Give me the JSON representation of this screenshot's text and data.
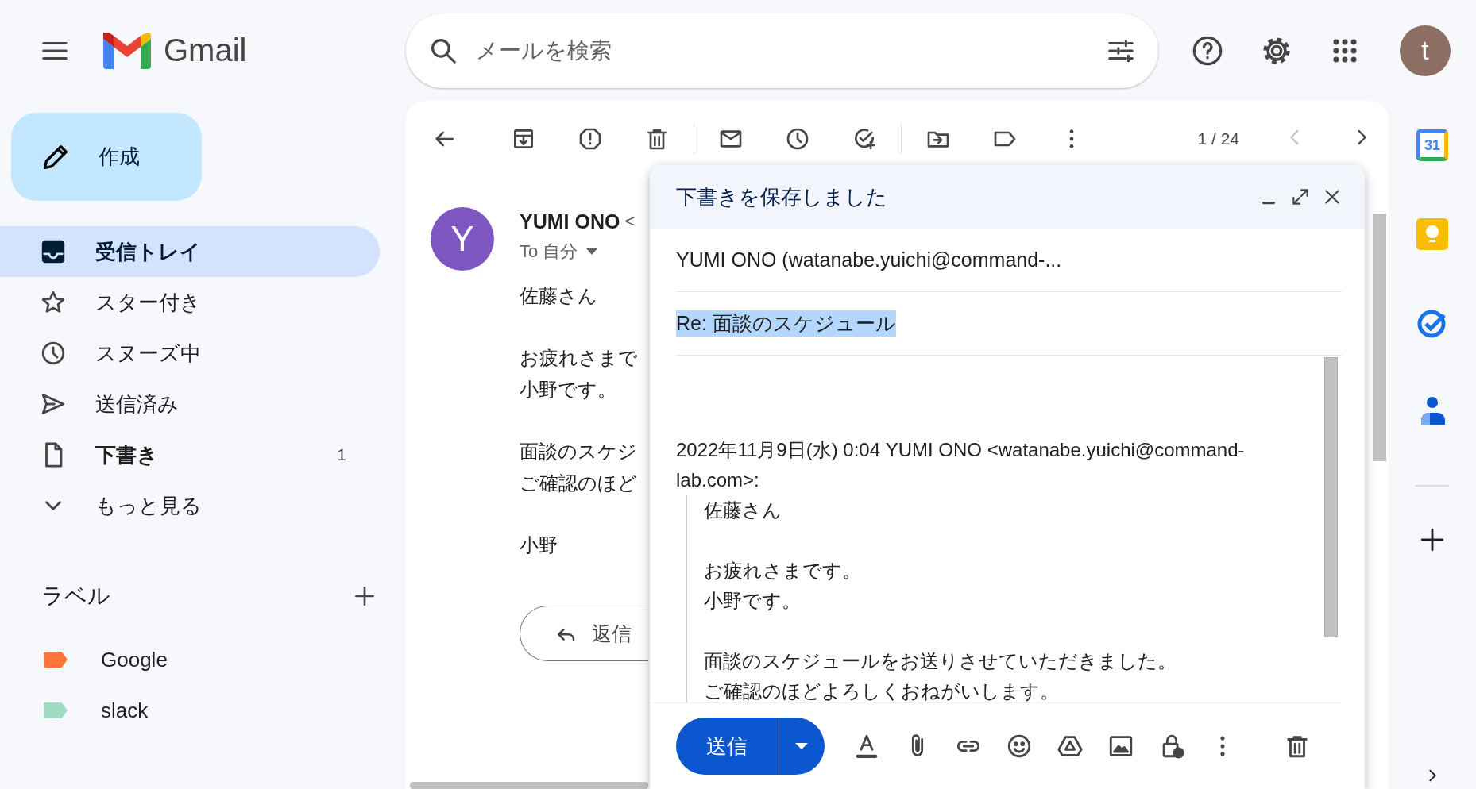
{
  "app": {
    "name": "Gmail"
  },
  "search": {
    "placeholder": "メールを検索"
  },
  "account": {
    "initial": "t"
  },
  "compose_button": {
    "label": "作成"
  },
  "nav": [
    {
      "label": "受信トレイ",
      "kind": "inbox",
      "selected": true,
      "unread": true
    },
    {
      "label": "スター付き",
      "kind": "star",
      "selected": false,
      "unread": false
    },
    {
      "label": "スヌーズ中",
      "kind": "clock",
      "selected": false,
      "unread": false
    },
    {
      "label": "送信済み",
      "kind": "send",
      "selected": false,
      "unread": false
    },
    {
      "label": "下書き",
      "kind": "draft",
      "selected": false,
      "unread": true,
      "count": "1"
    },
    {
      "label": "もっと見る",
      "kind": "more",
      "selected": false,
      "unread": false
    }
  ],
  "labels": {
    "title": "ラベル",
    "items": [
      {
        "name": "Google",
        "color": "#ff7537"
      },
      {
        "name": "slack",
        "color": "#a0dcc2"
      }
    ]
  },
  "toolbar": {
    "pager": "1 / 24",
    "prev_disabled": true,
    "next_disabled": false
  },
  "message": {
    "avatar_initial": "Y",
    "sender": "YUMI ONO",
    "sender_email": "<",
    "to": "To 自分",
    "paragraphs": [
      [
        "佐藤さん"
      ],
      [
        "お疲れさまで",
        "小野です。"
      ],
      [
        "面談のスケジ",
        "ご確認のほど"
      ],
      [
        "小野"
      ]
    ],
    "reply_label": "返信"
  },
  "compose": {
    "title": "下書きを保存しました",
    "recipients": "YUMI ONO (watanabe.yuichi@command-...",
    "subject": "Re: 面談のスケジュール",
    "subject_selected": true,
    "quote_header": "2022年11月9日(水) 0:04 YUMI ONO <watanabe.yuichi@command-lab.com>:",
    "quote": [
      [
        "佐藤さん"
      ],
      [
        "お疲れさまです。",
        "小野です。"
      ],
      [
        "面談のスケジュールをお送りさせていただきました。",
        "ご確認のほどよろしくおねがいします。"
      ]
    ],
    "send_label": "送信"
  },
  "side_panel": {
    "calendar_day": "31"
  }
}
